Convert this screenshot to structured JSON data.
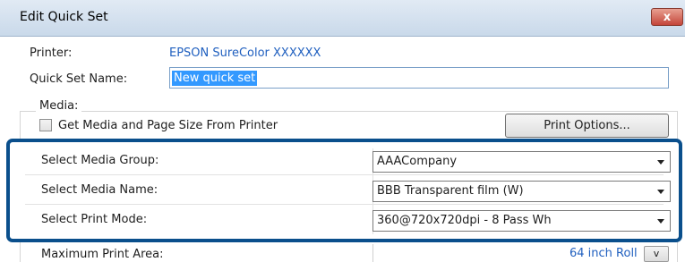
{
  "window": {
    "title": "Edit Quick Set",
    "close_symbol": "x"
  },
  "printer": {
    "label": "Printer:",
    "value": "EPSON SureColor XXXXXX"
  },
  "quick_set_name": {
    "label": "Quick Set Name:",
    "value": "New quick set"
  },
  "media": {
    "group_label": "Media:",
    "get_media_checkbox": {
      "label": "Get Media and Page Size From Printer",
      "checked": false
    },
    "print_options_button": "Print Options..."
  },
  "selections": [
    {
      "label": "Select Media Group:",
      "value": "AAACompany"
    },
    {
      "label": "Select Media Name:",
      "value": "BBB Transparent film (W)"
    },
    {
      "label": "Select Print Mode:",
      "value": "360@720x720dpi - 8 Pass Wh"
    }
  ],
  "max_print_area": {
    "label": "Maximum Print Area:",
    "value": "64 inch Roll",
    "button": "v"
  },
  "colors": {
    "highlight_border": "#0a4f8c",
    "link": "#1f5fbf",
    "selection": "#3399ff"
  }
}
